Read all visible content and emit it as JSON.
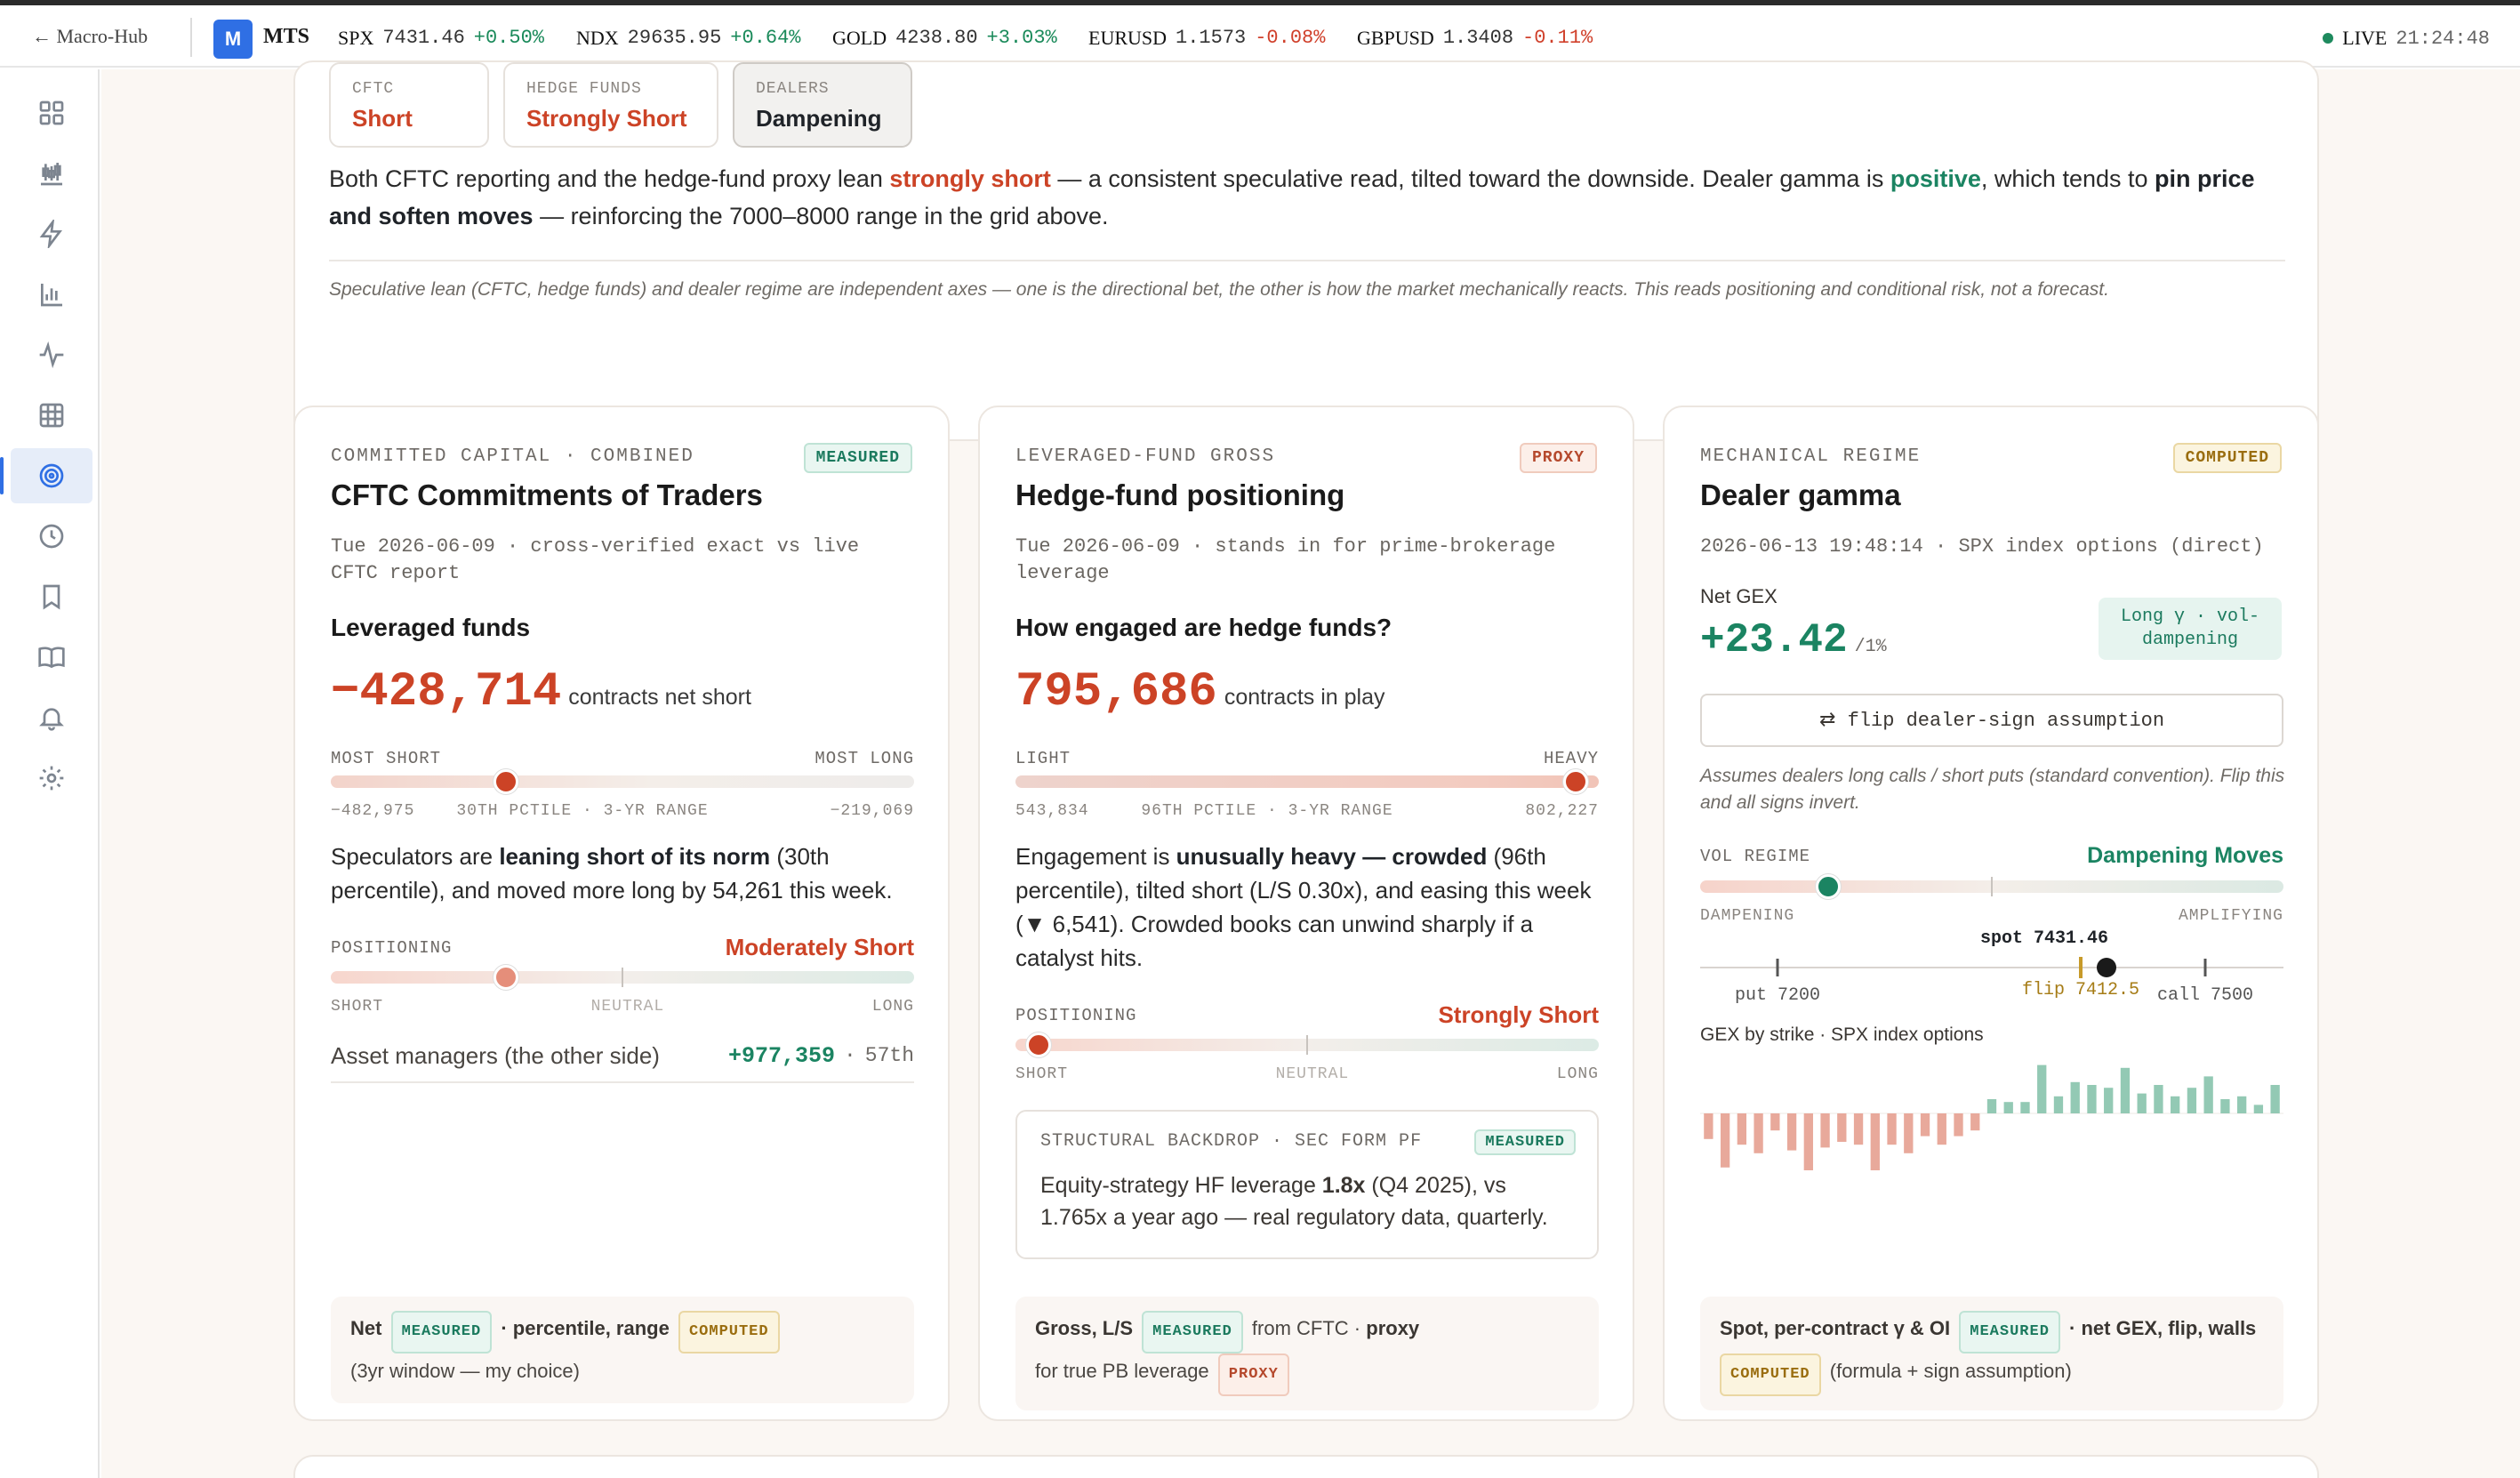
{
  "topbar": {
    "back_label": "← Macro-Hub",
    "logo_letter": "M",
    "brand": "MTS",
    "tickers": [
      {
        "sym": "SPX",
        "px": "7431.46",
        "chg": "+0.50%",
        "dir": "up"
      },
      {
        "sym": "NDX",
        "px": "29635.95",
        "chg": "+0.64%",
        "dir": "up"
      },
      {
        "sym": "GOLD",
        "px": "4238.80",
        "chg": "+3.03%",
        "dir": "up"
      },
      {
        "sym": "EURUSD",
        "px": "1.1573",
        "chg": "-0.08%",
        "dir": "down"
      },
      {
        "sym": "GBPUSD",
        "px": "1.3408",
        "chg": "-0.11%",
        "dir": "down"
      }
    ],
    "live_label": "LIVE",
    "time": "21:24:48"
  },
  "sidebar": {
    "items": [
      {
        "icon": "grid-icon"
      },
      {
        "icon": "candlestick-icon"
      },
      {
        "icon": "lightning-icon"
      },
      {
        "icon": "bar-chart-icon"
      },
      {
        "icon": "activity-icon"
      },
      {
        "icon": "table-icon"
      },
      {
        "icon": "target-icon",
        "active": true
      },
      {
        "icon": "clock-icon"
      },
      {
        "icon": "bookmark-icon"
      },
      {
        "icon": "book-icon"
      },
      {
        "icon": "bell-icon"
      },
      {
        "icon": "settings-icon"
      }
    ]
  },
  "summary_panel": {
    "chips": [
      {
        "key": "CFTC",
        "value": "Short",
        "color": "#cc4326"
      },
      {
        "key": "HEDGE FUNDS",
        "value": "Strongly Short",
        "color": "#cc4326"
      },
      {
        "key": "DEALERS",
        "value": "Dampening",
        "color": "#1f2328"
      }
    ],
    "text_1": "Both CFTC reporting and the hedge-fund proxy lean ",
    "text_2": "strongly short",
    "text_3": " — a consistent speculative read, tilted toward the downside. Dealer gamma is ",
    "text_4": "positive",
    "text_5": ", which tends to ",
    "text_6": "pin price and soften moves",
    "text_7": " — reinforcing the 7000–8000 range in the grid above.",
    "note": "Speculative lean (CFTC, hedge funds) and dealer regime are independent axes — one is the directional bet, the other is how the market mechanically reacts. This reads positioning and conditional risk, not a forecast."
  },
  "cftc": {
    "eyebrow": "COMMITTED CAPITAL · COMBINED",
    "badge": "MEASURED",
    "title": "CFTC Commitments of Traders",
    "sub": "Tue 2026-06-09 · cross-verified exact vs live CFTC report",
    "heading": "Leveraged funds",
    "value": "−428,714",
    "unit": "contracts net short",
    "scale_left": "MOST SHORT",
    "scale_right": "MOST LONG",
    "range_min": "−482,975",
    "range_mid": "30TH PCTILE · 3-YR RANGE",
    "range_max": "−219,069",
    "percentile": 0.3,
    "para_1": "Speculators are ",
    "para_2": "leaning short of its norm",
    "para_3": " (30th percentile), and moved more long by 54,261 this week.",
    "positioning_label": "POSITIONING",
    "positioning_value": "Moderately Short",
    "positioning_level": 0.3,
    "pos_short": "SHORT",
    "pos_neutral": "NEUTRAL",
    "pos_long": "LONG",
    "am_label": "Asset managers (the other side)",
    "am_value": "+977,359",
    "am_sep": "·",
    "am_pct": "57th",
    "foot_1": "Net",
    "foot_badge_1": "MEASURED",
    "foot_2": "· percentile, range",
    "foot_badge_2": "COMPUTED",
    "foot_3": "(3yr window — my choice)"
  },
  "hedge": {
    "eyebrow": "LEVERAGED-FUND GROSS",
    "badge": "PROXY",
    "title": "Hedge-fund positioning",
    "sub": "Tue 2026-06-09 · stands in for prime-brokerage leverage",
    "heading": "How engaged are hedge funds?",
    "value": "795,686",
    "unit": "contracts in play",
    "scale_left": "LIGHT",
    "scale_right": "HEAVY",
    "range_min": "543,834",
    "range_mid": "96TH PCTILE · 3-YR RANGE",
    "range_max": "802,227",
    "percentile": 0.96,
    "para_1": "Engagement is ",
    "para_2": "unusually heavy — crowded",
    "para_3": " (96th percentile), tilted short (L/S 0.30x), and easing this week (▼ 6,541). Crowded books can unwind sharply if a catalyst hits.",
    "positioning_label": "POSITIONING",
    "positioning_value": "Strongly Short",
    "positioning_level": 0.04,
    "pos_short": "SHORT",
    "pos_neutral": "NEUTRAL",
    "pos_long": "LONG",
    "inset_key": "STRUCTURAL BACKDROP · SEC FORM PF",
    "inset_badge": "MEASURED",
    "inset_1": "Equity-strategy HF leverage ",
    "inset_2": "1.8x",
    "inset_3": " (Q4 2025), vs 1.765x a year ago — real regulatory data, quarterly.",
    "foot_1": "Gross, L/S",
    "foot_badge_1": "MEASURED",
    "foot_2": "from CFTC ·",
    "foot_2b": "proxy",
    "foot_3": "for true PB leverage",
    "foot_badge_2": "PROXY"
  },
  "gamma": {
    "eyebrow": "MECHANICAL REGIME",
    "badge": "COMPUTED",
    "title": "Dealer gamma",
    "sub": "2026-06-13 19:48:14 · SPX index options (direct)",
    "net_label": "Net GEX",
    "net_value": "+23.42",
    "net_unit": "/1%",
    "regime_tag": "Long γ · vol-dampening",
    "flip_button": "⇄ flip dealer-sign assumption",
    "assume": "Assumes dealers long calls / short puts (standard convention). Flip this and all signs invert.",
    "vol_label": "VOL REGIME",
    "vol_value": "Dampening Moves",
    "vol_level": 0.22,
    "vol_left": "DAMPENING",
    "vol_right": "AMPLIFYING",
    "spot_label": "spot 7431.46",
    "put_label": "put 7200",
    "flip_label": "flip 7412.5",
    "call_label": "call 7500",
    "gex_subtitle": "GEX by strike · SPX index options",
    "foot_1": "Spot, per-contract γ & OI",
    "foot_badge_1": "MEASURED",
    "foot_2": "· net GEX, flip, walls",
    "foot_badge_2": "COMPUTED",
    "foot_3": "(formula + sign assumption)"
  },
  "chart_data": {
    "type": "bar",
    "title": "GEX by strike · SPX index options",
    "x_markers": {
      "put": 7200,
      "flip": 7412.5,
      "spot": 7431.46,
      "call": 7500
    },
    "values": [
      -0.45,
      -0.95,
      -0.55,
      -0.7,
      -0.3,
      -0.65,
      -1.0,
      -0.6,
      -0.5,
      -0.55,
      -1.0,
      -0.55,
      -0.7,
      -0.4,
      -0.55,
      -0.4,
      -0.3,
      0.25,
      0.2,
      0.2,
      0.85,
      0.3,
      0.55,
      0.5,
      0.45,
      0.8,
      0.35,
      0.5,
      0.3,
      0.45,
      0.65,
      0.25,
      0.3,
      0.15,
      0.5
    ],
    "colors": {
      "negative": "#e8a99b",
      "positive": "#93c9b4"
    }
  }
}
